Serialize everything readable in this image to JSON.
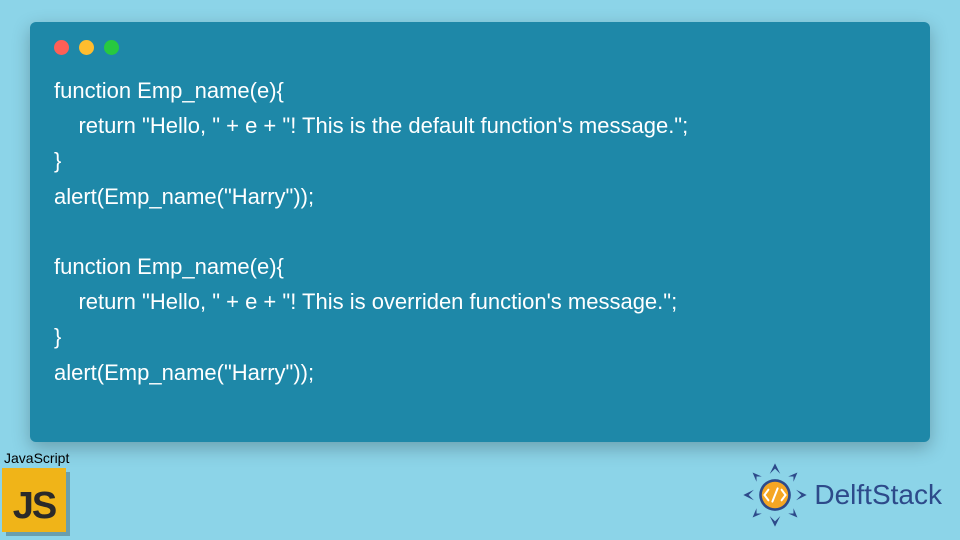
{
  "code": {
    "lines": [
      "function Emp_name(e){",
      "    return \"Hello, \" + e + \"! This is the default function's message.\";",
      "}",
      "alert(Emp_name(\"Harry\"));",
      "",
      "function Emp_name(e){",
      "    return \"Hello, \" + e + \"! This is overriden function's message.\";",
      "}",
      "alert(Emp_name(\"Harry\"));"
    ]
  },
  "badge": {
    "language_label": "JavaScript",
    "logo_text": "JS"
  },
  "brand": {
    "name": "DelftStack"
  }
}
